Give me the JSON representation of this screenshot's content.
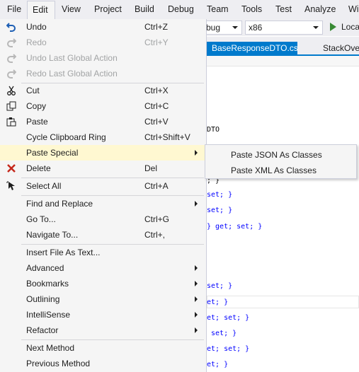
{
  "menubar": {
    "items": [
      "File",
      "Edit",
      "View",
      "Project",
      "Build",
      "Debug",
      "Team",
      "Tools",
      "Test",
      "Analyze",
      "Win"
    ]
  },
  "toolbar": {
    "config_combo": "bug",
    "platform_combo": "x86",
    "run_label": "Loca"
  },
  "tabs": [
    "BaseResponseDTO.cs",
    "StackOver"
  ],
  "code_fragments": [
    "DTO",
    "; }",
    "set; }",
    "set; }",
    "} get; set; }",
    "set; }",
    "et; }",
    "et; set; }",
    " set; }",
    "et; set; }",
    "et; }"
  ],
  "edit_menu": {
    "items": [
      {
        "label": "Undo",
        "shortcut": "Ctrl+Z",
        "icon": "undo-icon"
      },
      {
        "label": "Redo",
        "shortcut": "Ctrl+Y",
        "icon": "redo-icon"
      },
      {
        "label": "Undo Last Global Action",
        "shortcut": "",
        "icon": "undo-global-icon"
      },
      {
        "label": "Redo Last Global Action",
        "shortcut": "",
        "icon": "redo-global-icon"
      },
      {
        "label": "Cut",
        "shortcut": "Ctrl+X",
        "icon": "scissors-icon"
      },
      {
        "label": "Copy",
        "shortcut": "Ctrl+C",
        "icon": "copy-icon"
      },
      {
        "label": "Paste",
        "shortcut": "Ctrl+V",
        "icon": "paste-icon"
      },
      {
        "label": "Cycle Clipboard Ring",
        "shortcut": "Ctrl+Shift+V",
        "icon": ""
      },
      {
        "label": "Paste Special",
        "shortcut": "",
        "icon": ""
      },
      {
        "label": "Delete",
        "shortcut": "Del",
        "icon": "delete-x-icon"
      },
      {
        "label": "Select All",
        "shortcut": "Ctrl+A",
        "icon": "select-all-icon"
      },
      {
        "label": "Find and Replace",
        "shortcut": "",
        "icon": ""
      },
      {
        "label": "Go To...",
        "shortcut": "Ctrl+G",
        "icon": ""
      },
      {
        "label": "Navigate To...",
        "shortcut": "Ctrl+,",
        "icon": ""
      },
      {
        "label": "Insert File As Text...",
        "shortcut": "",
        "icon": ""
      },
      {
        "label": "Advanced",
        "shortcut": "",
        "icon": ""
      },
      {
        "label": "Bookmarks",
        "shortcut": "",
        "icon": ""
      },
      {
        "label": "Outlining",
        "shortcut": "",
        "icon": ""
      },
      {
        "label": "IntelliSense",
        "shortcut": "",
        "icon": ""
      },
      {
        "label": "Refactor",
        "shortcut": "",
        "icon": ""
      },
      {
        "label": "Next Method",
        "shortcut": "",
        "icon": ""
      },
      {
        "label": "Previous Method",
        "shortcut": "",
        "icon": ""
      }
    ]
  },
  "paste_special_submenu": {
    "items": [
      "Paste JSON As Classes",
      "Paste XML As Classes"
    ]
  },
  "colors": {
    "accent": "#007acc",
    "highlight": "#fff8d1",
    "menu_bg": "#f5f5f5",
    "disabled_text": "#a2a4a5",
    "delete_icon": "#c5281c",
    "run_green": "#388a34"
  }
}
